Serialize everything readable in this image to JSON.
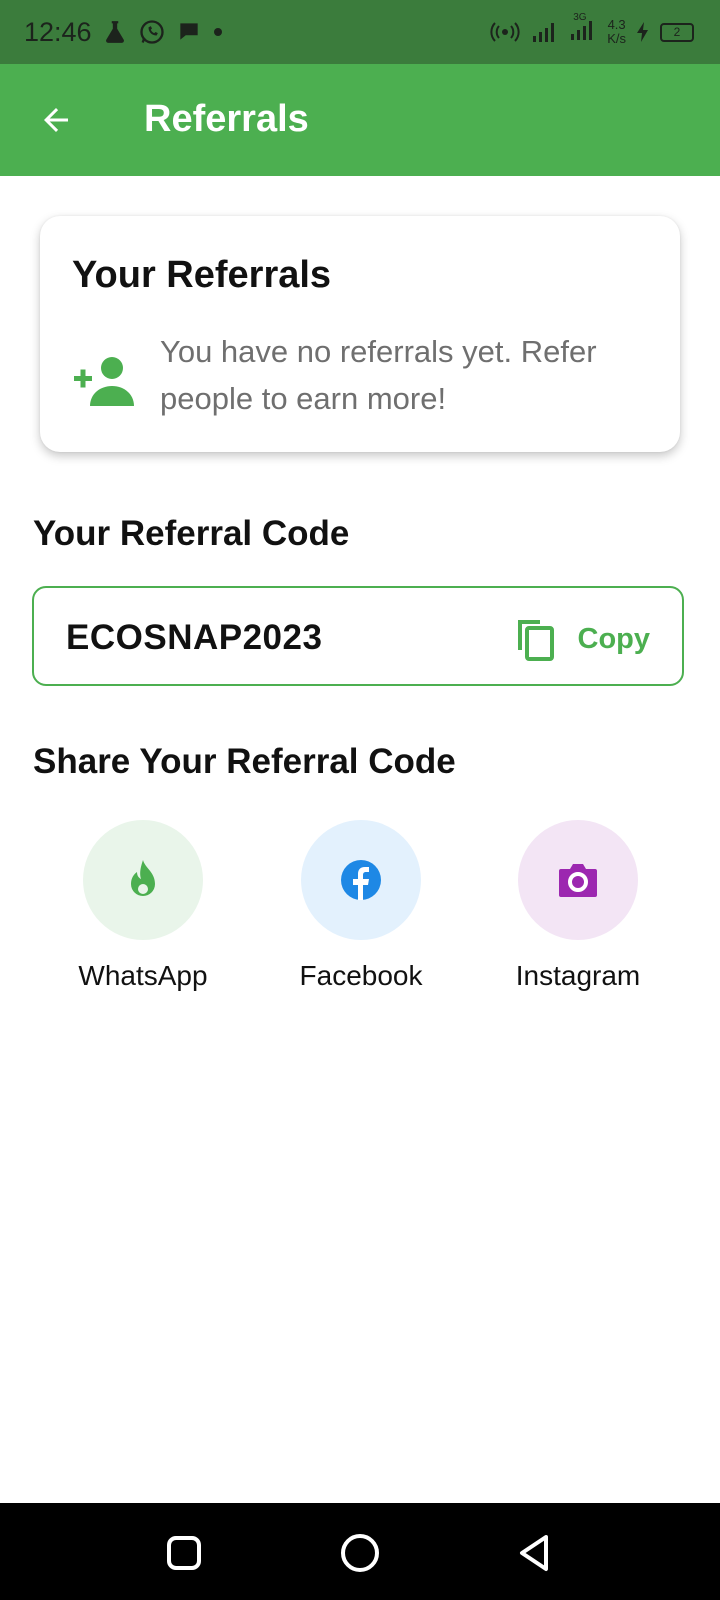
{
  "status_bar": {
    "time": "12:46",
    "speed_value": "4.3",
    "speed_unit": "K/s",
    "battery_level": "2",
    "network_label": "3G"
  },
  "app_bar": {
    "title": "Referrals",
    "back_icon": "arrow-left-icon"
  },
  "referrals_card": {
    "title": "Your Referrals",
    "icon": "person-add-icon",
    "empty_message": "You have no referrals yet. Refer people to earn more!"
  },
  "referral_code": {
    "heading": "Your Referral Code",
    "code": "ECOSNAP2023",
    "copy_label": "Copy",
    "copy_icon": "copy-icon"
  },
  "share": {
    "heading": "Share Your Referral Code",
    "options": [
      {
        "label": "WhatsApp",
        "icon": "flame-icon",
        "color": "#4caf50",
        "bg": "#e9f5ea"
      },
      {
        "label": "Facebook",
        "icon": "facebook-icon",
        "color": "#1e88e5",
        "bg": "#e3f1fd"
      },
      {
        "label": "Instagram",
        "icon": "camera-icon",
        "color": "#9c27b0",
        "bg": "#f3e5f5"
      }
    ]
  },
  "colors": {
    "primary": "#4caf50",
    "status_bar": "#3b7c3c",
    "secondary_text": "#6f6f6f"
  }
}
